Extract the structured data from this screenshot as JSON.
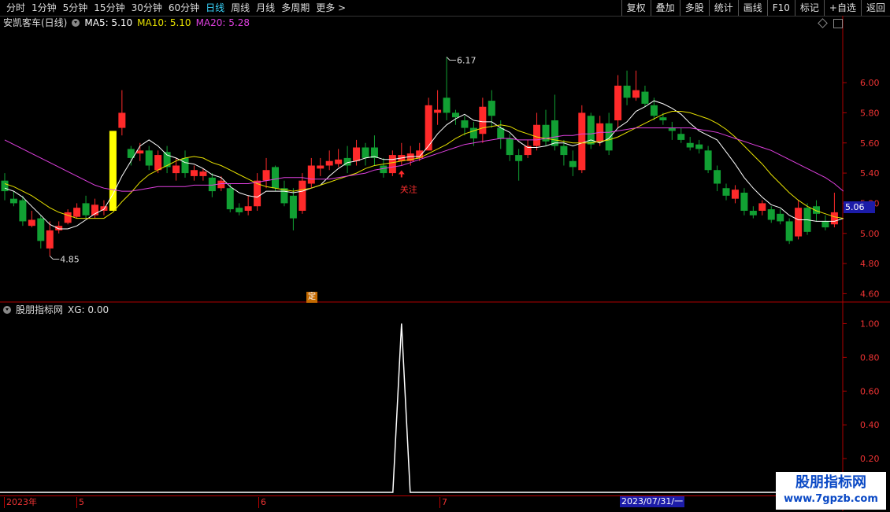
{
  "toolbar": {
    "periods": [
      {
        "label": "分时",
        "active": false
      },
      {
        "label": "1分钟",
        "active": false
      },
      {
        "label": "5分钟",
        "active": false
      },
      {
        "label": "15分钟",
        "active": false
      },
      {
        "label": "30分钟",
        "active": false
      },
      {
        "label": "60分钟",
        "active": false
      },
      {
        "label": "日线",
        "active": true
      },
      {
        "label": "周线",
        "active": false
      },
      {
        "label": "月线",
        "active": false
      },
      {
        "label": "多周期",
        "active": false
      },
      {
        "label": "更多 >",
        "active": false
      }
    ],
    "tools": [
      "复权",
      "叠加",
      "多股",
      "统计",
      "画线",
      "F10",
      "标记",
      "+自选",
      "返回"
    ]
  },
  "stock": {
    "title": "安凯客车(日线)",
    "ma5_label": "MA5: 5.10",
    "ma10_label": "MA10: 5.10",
    "ma20_label": "MA20: 5.28"
  },
  "indicator": {
    "title": "股朋指标网",
    "xg_label": "XG: 0.00"
  },
  "markers": {
    "high": "6.17",
    "low": "4.85",
    "attention": "关注",
    "fixed_tag": "定",
    "last_price": "5.06"
  },
  "date_axis": {
    "labels": [
      {
        "text": "2023年",
        "x": 5
      },
      {
        "text": "5",
        "x": 97
      },
      {
        "text": "6",
        "x": 328
      },
      {
        "text": "7",
        "x": 558
      }
    ],
    "cursor_date": "2023/07/31/一"
  },
  "watermark": {
    "line1": "股朋指标网",
    "line2": "www.7gpzb.com"
  },
  "colors": {
    "up": "#ff2a2a",
    "down": "#11a033",
    "ma5": "#ffffff",
    "ma10": "#e8e200",
    "ma20": "#e040e0",
    "axis": "#b00000"
  },
  "chart_data": [
    {
      "type": "candlestick",
      "title": "安凯客车(日线)",
      "price_ticks": [
        "6.00",
        "5.80",
        "5.60",
        "5.40",
        "5.20",
        "5.00",
        "4.80",
        "4.60"
      ],
      "ylim": [
        4.55,
        6.35
      ],
      "x_unit": "trading day index",
      "candles": [
        {
          "o": 5.35,
          "c": 5.28,
          "h": 5.4,
          "l": 5.22
        },
        {
          "o": 5.23,
          "c": 5.2,
          "h": 5.28,
          "l": 5.18
        },
        {
          "o": 5.22,
          "c": 5.08,
          "h": 5.25,
          "l": 5.05
        },
        {
          "o": 5.05,
          "c": 5.09,
          "h": 5.15,
          "l": 5.04
        },
        {
          "o": 5.1,
          "c": 4.95,
          "h": 5.12,
          "l": 4.9
        },
        {
          "o": 4.9,
          "c": 5.02,
          "h": 5.08,
          "l": 4.85
        },
        {
          "o": 5.02,
          "c": 5.05,
          "h": 5.08,
          "l": 5.0
        },
        {
          "o": 5.07,
          "c": 5.14,
          "h": 5.16,
          "l": 5.06
        },
        {
          "o": 5.11,
          "c": 5.17,
          "h": 5.2,
          "l": 5.1
        },
        {
          "o": 5.2,
          "c": 5.12,
          "h": 5.25,
          "l": 5.1
        },
        {
          "o": 5.12,
          "c": 5.19,
          "h": 5.23,
          "l": 5.1
        },
        {
          "o": 5.15,
          "c": 5.18,
          "h": 5.22,
          "l": 5.12
        },
        {
          "o": 5.15,
          "c": 5.68,
          "h": 5.68,
          "l": 5.15
        },
        {
          "o": 5.7,
          "c": 5.8,
          "h": 5.95,
          "l": 5.65
        },
        {
          "o": 5.56,
          "c": 5.5,
          "h": 5.58,
          "l": 5.45
        },
        {
          "o": 5.53,
          "c": 5.55,
          "h": 5.6,
          "l": 5.48
        },
        {
          "o": 5.55,
          "c": 5.45,
          "h": 5.58,
          "l": 5.42
        },
        {
          "o": 5.42,
          "c": 5.52,
          "h": 5.55,
          "l": 5.4
        },
        {
          "o": 5.54,
          "c": 5.44,
          "h": 5.58,
          "l": 5.4
        },
        {
          "o": 5.4,
          "c": 5.45,
          "h": 5.5,
          "l": 5.35
        },
        {
          "o": 5.5,
          "c": 5.4,
          "h": 5.55,
          "l": 5.37
        },
        {
          "o": 5.38,
          "c": 5.42,
          "h": 5.45,
          "l": 5.35
        },
        {
          "o": 5.38,
          "c": 5.41,
          "h": 5.43,
          "l": 5.35
        },
        {
          "o": 5.37,
          "c": 5.28,
          "h": 5.4,
          "l": 5.24
        },
        {
          "o": 5.3,
          "c": 5.35,
          "h": 5.38,
          "l": 5.28
        },
        {
          "o": 5.3,
          "c": 5.16,
          "h": 5.33,
          "l": 5.14
        },
        {
          "o": 5.17,
          "c": 5.14,
          "h": 5.2,
          "l": 5.12
        },
        {
          "o": 5.15,
          "c": 5.18,
          "h": 5.25,
          "l": 5.12
        },
        {
          "o": 5.18,
          "c": 5.35,
          "h": 5.4,
          "l": 5.15
        },
        {
          "o": 5.35,
          "c": 5.42,
          "h": 5.5,
          "l": 5.3
        },
        {
          "o": 5.44,
          "c": 5.3,
          "h": 5.45,
          "l": 5.28
        },
        {
          "o": 5.3,
          "c": 5.2,
          "h": 5.35,
          "l": 5.18
        },
        {
          "o": 5.25,
          "c": 5.1,
          "h": 5.3,
          "l": 5.02
        },
        {
          "o": 5.15,
          "c": 5.35,
          "h": 5.4,
          "l": 5.13
        },
        {
          "o": 5.33,
          "c": 5.45,
          "h": 5.5,
          "l": 5.3
        },
        {
          "o": 5.43,
          "c": 5.45,
          "h": 5.5,
          "l": 5.38
        },
        {
          "o": 5.45,
          "c": 5.48,
          "h": 5.55,
          "l": 5.42
        },
        {
          "o": 5.46,
          "c": 5.49,
          "h": 5.56,
          "l": 5.44
        },
        {
          "o": 5.5,
          "c": 5.45,
          "h": 5.58,
          "l": 5.4
        },
        {
          "o": 5.48,
          "c": 5.57,
          "h": 5.62,
          "l": 5.45
        },
        {
          "o": 5.57,
          "c": 5.5,
          "h": 5.6,
          "l": 5.45
        },
        {
          "o": 5.57,
          "c": 5.5,
          "h": 5.65,
          "l": 5.45
        },
        {
          "o": 5.45,
          "c": 5.4,
          "h": 5.5,
          "l": 5.37
        },
        {
          "o": 5.4,
          "c": 5.52,
          "h": 5.55,
          "l": 5.38
        },
        {
          "o": 5.48,
          "c": 5.52,
          "h": 5.6,
          "l": 5.45
        },
        {
          "o": 5.48,
          "c": 5.53,
          "h": 5.58,
          "l": 5.45
        },
        {
          "o": 5.5,
          "c": 5.55,
          "h": 5.6,
          "l": 5.48
        },
        {
          "o": 5.55,
          "c": 5.85,
          "h": 5.9,
          "l": 5.55
        },
        {
          "o": 5.8,
          "c": 5.82,
          "h": 5.95,
          "l": 5.72
        },
        {
          "o": 5.9,
          "c": 5.8,
          "h": 6.17,
          "l": 5.75
        },
        {
          "o": 5.8,
          "c": 5.77,
          "h": 5.82,
          "l": 5.72
        },
        {
          "o": 5.75,
          "c": 5.7,
          "h": 5.78,
          "l": 5.65
        },
        {
          "o": 5.7,
          "c": 5.63,
          "h": 5.74,
          "l": 5.58
        },
        {
          "o": 5.66,
          "c": 5.84,
          "h": 5.9,
          "l": 5.6
        },
        {
          "o": 5.88,
          "c": 5.78,
          "h": 5.95,
          "l": 5.7
        },
        {
          "o": 5.7,
          "c": 5.63,
          "h": 5.75,
          "l": 5.56
        },
        {
          "o": 5.63,
          "c": 5.52,
          "h": 5.66,
          "l": 5.48
        },
        {
          "o": 5.52,
          "c": 5.48,
          "h": 5.56,
          "l": 5.35
        },
        {
          "o": 5.52,
          "c": 5.58,
          "h": 5.62,
          "l": 5.5
        },
        {
          "o": 5.58,
          "c": 5.72,
          "h": 5.8,
          "l": 5.55
        },
        {
          "o": 5.72,
          "c": 5.61,
          "h": 5.82,
          "l": 5.58
        },
        {
          "o": 5.75,
          "c": 5.58,
          "h": 5.92,
          "l": 5.55
        },
        {
          "o": 5.58,
          "c": 5.52,
          "h": 5.62,
          "l": 5.45
        },
        {
          "o": 5.48,
          "c": 5.44,
          "h": 5.55,
          "l": 5.38
        },
        {
          "o": 5.42,
          "c": 5.8,
          "h": 5.85,
          "l": 5.4
        },
        {
          "o": 5.78,
          "c": 5.59,
          "h": 5.8,
          "l": 5.56
        },
        {
          "o": 5.61,
          "c": 5.73,
          "h": 5.78,
          "l": 5.58
        },
        {
          "o": 5.73,
          "c": 5.55,
          "h": 5.8,
          "l": 5.52
        },
        {
          "o": 5.75,
          "c": 5.98,
          "h": 6.05,
          "l": 5.7
        },
        {
          "o": 5.98,
          "c": 5.9,
          "h": 6.08,
          "l": 5.85
        },
        {
          "o": 5.9,
          "c": 5.95,
          "h": 6.08,
          "l": 5.88
        },
        {
          "o": 5.94,
          "c": 5.86,
          "h": 5.98,
          "l": 5.84
        },
        {
          "o": 5.85,
          "c": 5.78,
          "h": 5.9,
          "l": 5.75
        },
        {
          "o": 5.77,
          "c": 5.75,
          "h": 5.8,
          "l": 5.72
        },
        {
          "o": 5.7,
          "c": 5.68,
          "h": 5.74,
          "l": 5.62
        },
        {
          "o": 5.66,
          "c": 5.62,
          "h": 5.7,
          "l": 5.6
        },
        {
          "o": 5.6,
          "c": 5.57,
          "h": 5.64,
          "l": 5.55
        },
        {
          "o": 5.59,
          "c": 5.56,
          "h": 5.62,
          "l": 5.53
        },
        {
          "o": 5.55,
          "c": 5.42,
          "h": 5.58,
          "l": 5.4
        },
        {
          "o": 5.42,
          "c": 5.33,
          "h": 5.45,
          "l": 5.28
        },
        {
          "o": 5.3,
          "c": 5.25,
          "h": 5.33,
          "l": 5.22
        },
        {
          "o": 5.23,
          "c": 5.29,
          "h": 5.32,
          "l": 5.2
        },
        {
          "o": 5.27,
          "c": 5.15,
          "h": 5.3,
          "l": 5.12
        },
        {
          "o": 5.15,
          "c": 5.12,
          "h": 5.18,
          "l": 5.1
        },
        {
          "o": 5.15,
          "c": 5.2,
          "h": 5.22,
          "l": 5.12
        },
        {
          "o": 5.16,
          "c": 5.09,
          "h": 5.18,
          "l": 5.07
        },
        {
          "o": 5.13,
          "c": 5.08,
          "h": 5.16,
          "l": 5.06
        },
        {
          "o": 5.08,
          "c": 4.95,
          "h": 5.1,
          "l": 4.93
        },
        {
          "o": 4.98,
          "c": 5.17,
          "h": 5.22,
          "l": 4.96
        },
        {
          "o": 5.17,
          "c": 5.01,
          "h": 5.2,
          "l": 4.99
        },
        {
          "o": 5.18,
          "c": 5.13,
          "h": 5.22,
          "l": 5.08
        },
        {
          "o": 5.08,
          "c": 5.04,
          "h": 5.12,
          "l": 5.02
        },
        {
          "o": 5.06,
          "c": 5.14,
          "h": 5.27,
          "l": 5.04
        }
      ],
      "series": [
        {
          "name": "MA5",
          "values": [
            5.3,
            5.28,
            5.24,
            5.18,
            5.12,
            5.06,
            5.03,
            5.03,
            5.05,
            5.09,
            5.13,
            5.16,
            5.26,
            5.38,
            5.48,
            5.58,
            5.62,
            5.58,
            5.52,
            5.5,
            5.47,
            5.46,
            5.43,
            5.39,
            5.37,
            5.31,
            5.27,
            5.25,
            5.24,
            5.28,
            5.28,
            5.28,
            5.27,
            5.28,
            5.3,
            5.32,
            5.38,
            5.43,
            5.47,
            5.48,
            5.5,
            5.51,
            5.49,
            5.49,
            5.5,
            5.51,
            5.51,
            5.58,
            5.66,
            5.72,
            5.76,
            5.79,
            5.75,
            5.74,
            5.74,
            5.7,
            5.67,
            5.61,
            5.57,
            5.57,
            5.58,
            5.6,
            5.6,
            5.58,
            5.6,
            5.62,
            5.6,
            5.63,
            5.7,
            5.74,
            5.81,
            5.84,
            5.88,
            5.86,
            5.83,
            5.79,
            5.73,
            5.68,
            5.65,
            5.62,
            5.54,
            5.46,
            5.37,
            5.3,
            5.24,
            5.19,
            5.17,
            5.12,
            5.09,
            5.09,
            5.08,
            5.08,
            5.08,
            5.1
          ]
        },
        {
          "name": "MA10",
          "values": [
            5.33,
            5.31,
            5.28,
            5.25,
            5.21,
            5.17,
            5.14,
            5.12,
            5.1,
            5.1,
            5.1,
            5.1,
            5.14,
            5.21,
            5.27,
            5.34,
            5.39,
            5.42,
            5.45,
            5.48,
            5.5,
            5.51,
            5.5,
            5.47,
            5.45,
            5.42,
            5.39,
            5.36,
            5.33,
            5.31,
            5.3,
            5.29,
            5.28,
            5.29,
            5.3,
            5.32,
            5.34,
            5.36,
            5.38,
            5.4,
            5.43,
            5.45,
            5.46,
            5.47,
            5.48,
            5.49,
            5.5,
            5.53,
            5.56,
            5.59,
            5.63,
            5.66,
            5.68,
            5.7,
            5.71,
            5.72,
            5.71,
            5.68,
            5.66,
            5.64,
            5.63,
            5.62,
            5.61,
            5.6,
            5.6,
            5.6,
            5.61,
            5.62,
            5.64,
            5.67,
            5.7,
            5.73,
            5.76,
            5.79,
            5.81,
            5.81,
            5.8,
            5.78,
            5.76,
            5.73,
            5.69,
            5.64,
            5.58,
            5.52,
            5.46,
            5.39,
            5.33,
            5.27,
            5.22,
            5.18,
            5.15,
            5.13,
            5.11,
            5.1
          ]
        },
        {
          "name": "MA20",
          "values": [
            5.62,
            5.59,
            5.56,
            5.53,
            5.5,
            5.47,
            5.44,
            5.41,
            5.38,
            5.35,
            5.32,
            5.3,
            5.29,
            5.28,
            5.28,
            5.29,
            5.3,
            5.31,
            5.31,
            5.31,
            5.31,
            5.32,
            5.32,
            5.32,
            5.33,
            5.33,
            5.33,
            5.33,
            5.34,
            5.35,
            5.36,
            5.37,
            5.37,
            5.37,
            5.36,
            5.36,
            5.36,
            5.37,
            5.38,
            5.39,
            5.4,
            5.42,
            5.43,
            5.44,
            5.45,
            5.47,
            5.49,
            5.51,
            5.53,
            5.55,
            5.57,
            5.59,
            5.6,
            5.61,
            5.62,
            5.63,
            5.63,
            5.62,
            5.62,
            5.62,
            5.63,
            5.64,
            5.65,
            5.65,
            5.66,
            5.66,
            5.67,
            5.67,
            5.68,
            5.69,
            5.7,
            5.7,
            5.7,
            5.7,
            5.7,
            5.7,
            5.7,
            5.69,
            5.68,
            5.67,
            5.65,
            5.63,
            5.61,
            5.59,
            5.57,
            5.55,
            5.52,
            5.49,
            5.46,
            5.43,
            5.4,
            5.37,
            5.33,
            5.28
          ]
        }
      ]
    },
    {
      "type": "line",
      "title": "股朋指标网",
      "ylim": [
        0,
        1.1
      ],
      "y_ticks": [
        "1.00",
        "0.80",
        "0.60",
        "0.40",
        "0.20"
      ],
      "spike_index": 44,
      "count": 94,
      "series": [
        {
          "name": "XG",
          "spike_value": 1.0
        }
      ]
    }
  ]
}
